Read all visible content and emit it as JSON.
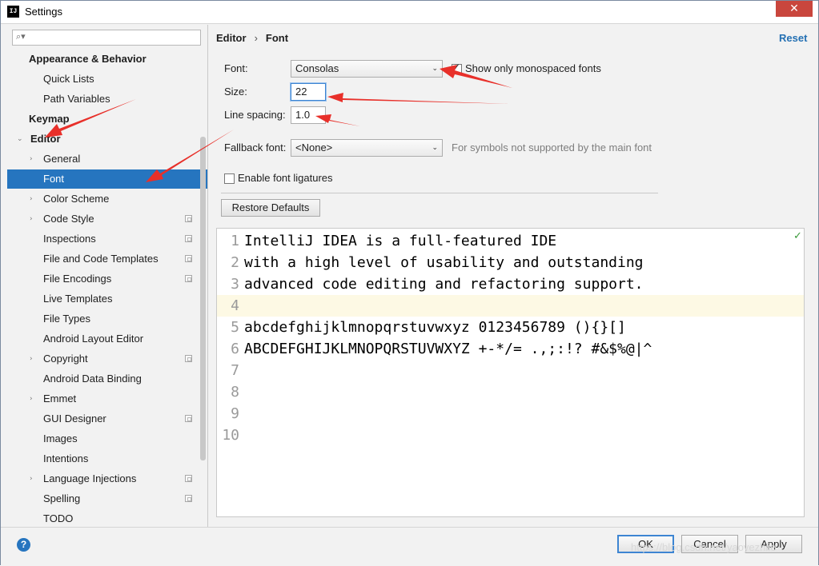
{
  "window": {
    "title": "Settings",
    "close_glyph": "✕"
  },
  "search": {
    "placeholder": "",
    "icon": "search-icon"
  },
  "sidebar": {
    "items": [
      {
        "label": "Appearance & Behavior",
        "indent": 0,
        "bold": true,
        "arrow": "",
        "proj": false
      },
      {
        "label": "Quick Lists",
        "indent": 1,
        "bold": false,
        "arrow": "",
        "proj": false
      },
      {
        "label": "Path Variables",
        "indent": 1,
        "bold": false,
        "arrow": "",
        "proj": false
      },
      {
        "label": "Keymap",
        "indent": 0,
        "bold": true,
        "arrow": "",
        "proj": false
      },
      {
        "label": "Editor",
        "indent": 0,
        "bold": true,
        "arrow": "⌄",
        "proj": false
      },
      {
        "label": "General",
        "indent": 1,
        "bold": false,
        "arrow": "›",
        "proj": false
      },
      {
        "label": "Font",
        "indent": 1,
        "bold": false,
        "arrow": "",
        "proj": false,
        "selected": true
      },
      {
        "label": "Color Scheme",
        "indent": 1,
        "bold": false,
        "arrow": "›",
        "proj": false
      },
      {
        "label": "Code Style",
        "indent": 1,
        "bold": false,
        "arrow": "›",
        "proj": true
      },
      {
        "label": "Inspections",
        "indent": 1,
        "bold": false,
        "arrow": "",
        "proj": true
      },
      {
        "label": "File and Code Templates",
        "indent": 1,
        "bold": false,
        "arrow": "",
        "proj": true
      },
      {
        "label": "File Encodings",
        "indent": 1,
        "bold": false,
        "arrow": "",
        "proj": true
      },
      {
        "label": "Live Templates",
        "indent": 1,
        "bold": false,
        "arrow": "",
        "proj": false
      },
      {
        "label": "File Types",
        "indent": 1,
        "bold": false,
        "arrow": "",
        "proj": false
      },
      {
        "label": "Android Layout Editor",
        "indent": 1,
        "bold": false,
        "arrow": "",
        "proj": false
      },
      {
        "label": "Copyright",
        "indent": 1,
        "bold": false,
        "arrow": "›",
        "proj": true
      },
      {
        "label": "Android Data Binding",
        "indent": 1,
        "bold": false,
        "arrow": "",
        "proj": false
      },
      {
        "label": "Emmet",
        "indent": 1,
        "bold": false,
        "arrow": "›",
        "proj": false
      },
      {
        "label": "GUI Designer",
        "indent": 1,
        "bold": false,
        "arrow": "",
        "proj": true
      },
      {
        "label": "Images",
        "indent": 1,
        "bold": false,
        "arrow": "",
        "proj": false
      },
      {
        "label": "Intentions",
        "indent": 1,
        "bold": false,
        "arrow": "",
        "proj": false
      },
      {
        "label": "Language Injections",
        "indent": 1,
        "bold": false,
        "arrow": "›",
        "proj": true
      },
      {
        "label": "Spelling",
        "indent": 1,
        "bold": false,
        "arrow": "",
        "proj": true
      },
      {
        "label": "TODO",
        "indent": 1,
        "bold": false,
        "arrow": "",
        "proj": false
      }
    ]
  },
  "breadcrumb": {
    "parent": "Editor",
    "separator": "›",
    "current": "Font"
  },
  "reset_label": "Reset",
  "form": {
    "font_label": "Font:",
    "font_value": "Consolas",
    "monospace_label": "Show only monospaced fonts",
    "monospace_checked": true,
    "size_label": "Size:",
    "size_value": "22",
    "line_spacing_label": "Line spacing:",
    "line_spacing_value": "1.0",
    "fallback_label": "Fallback font:",
    "fallback_value": "<None>",
    "fallback_hint": "For symbols not supported by the main font",
    "ligatures_label": "Enable font ligatures",
    "ligatures_checked": false,
    "restore_label": "Restore Defaults",
    "chevron": "⌄"
  },
  "preview": {
    "ok_icon": "✓",
    "lines": [
      {
        "num": "1",
        "text": "IntelliJ IDEA is a full-featured IDE"
      },
      {
        "num": "2",
        "text": "with a high level of usability and outstanding"
      },
      {
        "num": "3",
        "text": "advanced code editing and refactoring support."
      },
      {
        "num": "4",
        "text": ""
      },
      {
        "num": "5",
        "text": "abcdefghijklmnopqrstuvwxyz 0123456789 (){}[]"
      },
      {
        "num": "6",
        "text": "ABCDEFGHIJKLMNOPQRSTUVWXYZ +-*/= .,;:!? #&$%@|^"
      },
      {
        "num": "7",
        "text": ""
      },
      {
        "num": "8",
        "text": ""
      },
      {
        "num": "9",
        "text": ""
      },
      {
        "num": "10",
        "text": ""
      }
    ],
    "current_line": 4
  },
  "buttons": {
    "help": "?",
    "ok": "OK",
    "cancel": "Cancel",
    "apply": "Apply"
  },
  "watermark": "https://blog.csdn.net/yaoyezhiie",
  "colors": {
    "selection": "#2675bf",
    "link": "#2470b3",
    "annotation_arrow": "#e8302a",
    "current_line": "#fdf9e4"
  }
}
